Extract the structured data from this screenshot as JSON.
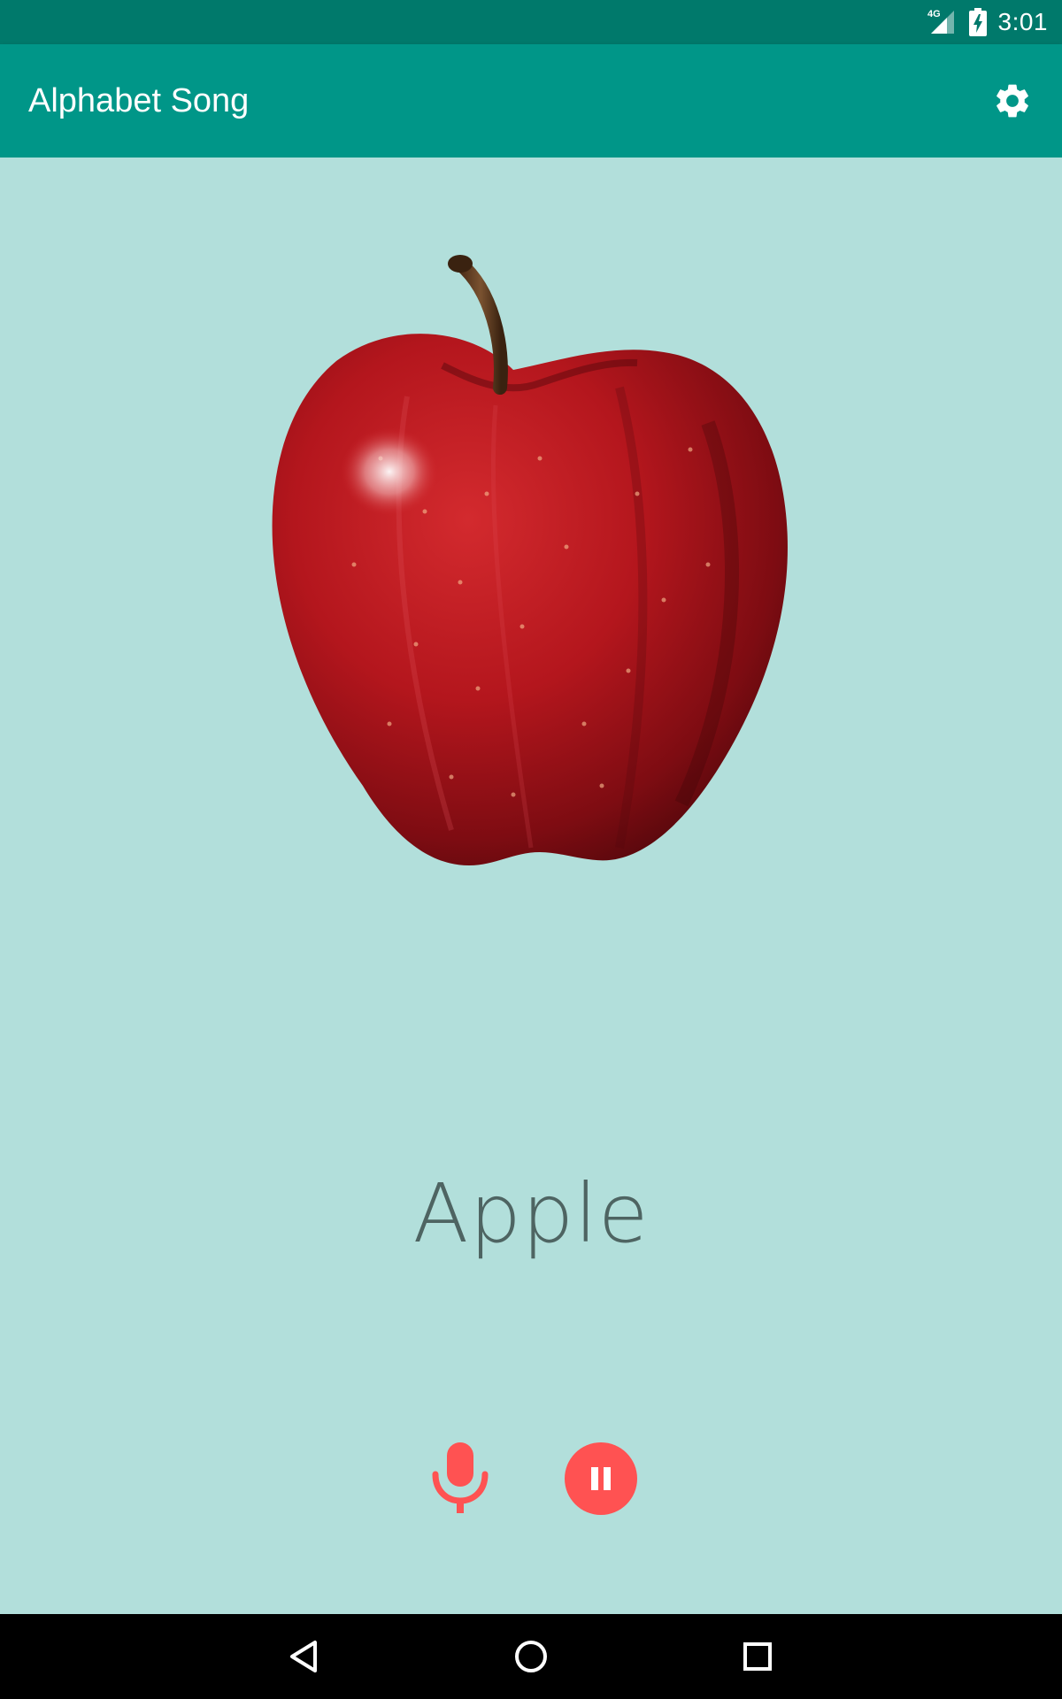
{
  "status_bar": {
    "network_label": "4G",
    "time": "3:01"
  },
  "app_bar": {
    "title": "Alphabet Song",
    "settings_icon": "gear-icon"
  },
  "card": {
    "image_subject": "apple",
    "word": "Apple"
  },
  "controls": {
    "mic_icon": "microphone-icon",
    "pause_icon": "pause-icon"
  },
  "nav_bar": {
    "back_icon": "back-triangle-icon",
    "home_icon": "home-circle-icon",
    "recents_icon": "recents-square-icon"
  },
  "colors": {
    "status_bar": "#00796b",
    "app_bar": "#009688",
    "background": "#b2dfdb",
    "accent": "#ff5252",
    "word_text": "#4e6462"
  }
}
